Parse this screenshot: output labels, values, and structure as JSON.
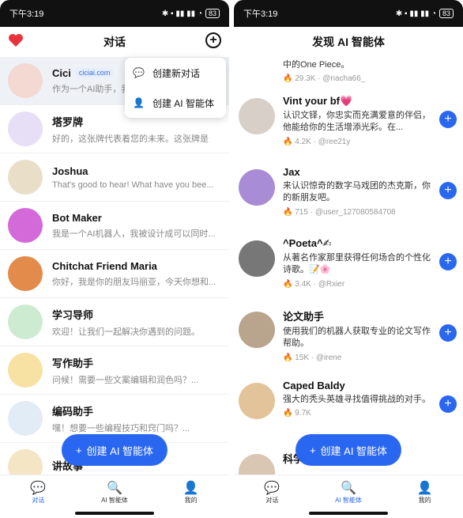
{
  "status": {
    "time": "下午3:19",
    "battery": "83"
  },
  "left": {
    "title": "对话",
    "heart_icon": "heart-icon",
    "popup": [
      {
        "label": "创建新对话",
        "icon": "chat-bubble-icon"
      },
      {
        "label": "创建 AI 智能体",
        "icon": "person-icon"
      }
    ],
    "chats": [
      {
        "name": "Cici",
        "tag": "ciciai.com",
        "msg": "作为一个AI助手，我",
        "color": "#f3d9d2"
      },
      {
        "name": "塔罗牌",
        "tag": "",
        "msg": "好的，这张牌代表着您的未来。这张牌是",
        "color": "#e7dff5"
      },
      {
        "name": "Joshua",
        "tag": "",
        "msg": "That's good to hear! What have you bee...",
        "color": "#e9dfc9"
      },
      {
        "name": "Bot Maker",
        "tag": "",
        "msg": "我是一个AI机器人，我被设计成可以同时...",
        "color": "#d46ad9"
      },
      {
        "name": "Chitchat Friend Maria",
        "tag": "",
        "msg": "你好，我是你的朋友玛丽亚，今天你想和...",
        "color": "#e28b4a"
      },
      {
        "name": "学习导师",
        "tag": "",
        "msg": "欢迎！让我们一起解决你遇到的问题。",
        "color": "#cdebd0"
      },
      {
        "name": "写作助手",
        "tag": "",
        "msg": "问候！需要一些文案编辑和润色吗？...",
        "color": "#f7e2a4"
      },
      {
        "name": "编码助手",
        "tag": "",
        "msg": "嘿！想要一些编程技巧和窍门吗？...",
        "color": "#e2ecf6"
      },
      {
        "name": "讲故事",
        "tag": "",
        "msg": "",
        "color": "#f4e6c4"
      }
    ],
    "fab": "创建 AI 智能体"
  },
  "right": {
    "title": "发现 AI 智能体",
    "agents": [
      {
        "name": "",
        "desc": "中的One Piece。",
        "likes": "29.3K",
        "user": "@nacha66_",
        "color": "#e8d3c4"
      },
      {
        "name": "Vint your bf💗",
        "desc": "认识文铎，你忠实而充满爱意的伴侣，他能给你的生活增添光彩。在...",
        "likes": "4.2K",
        "user": "@ree21y",
        "color": "#d8d0c8"
      },
      {
        "name": "Jax",
        "desc": "来认识惊奇的数字马戏团的杰克斯，你的新朋友吧。",
        "likes": "715",
        "user": "@user_127080584708",
        "color": "#a88dd6"
      },
      {
        "name": "^Poeta^✍",
        "desc": "从著名作家那里获得任何场合的个性化诗歌。📝🌸",
        "likes": "3.4K",
        "user": "@Rxier",
        "color": "#777"
      },
      {
        "name": "论文助手",
        "desc": "使用我们的机器人获取专业的论文写作帮助。",
        "likes": "15K",
        "user": "@irene",
        "color": "#b9a48d"
      },
      {
        "name": "Caped Baldy",
        "desc": "强大的秃头英雄寻找值得挑战的对手。",
        "likes": "9.7K",
        "user": "",
        "color": "#e3c49a"
      },
      {
        "name": "科学先生",
        "desc": "",
        "likes": "",
        "user": "",
        "color": "#d9c7b3"
      }
    ],
    "fab": "创建 AI 智能体"
  },
  "tabs": [
    {
      "label": "对话",
      "icon": "chat-tab-icon"
    },
    {
      "label": "AI 智能体",
      "icon": "search-tab-icon"
    },
    {
      "label": "我的",
      "icon": "profile-tab-icon"
    }
  ]
}
